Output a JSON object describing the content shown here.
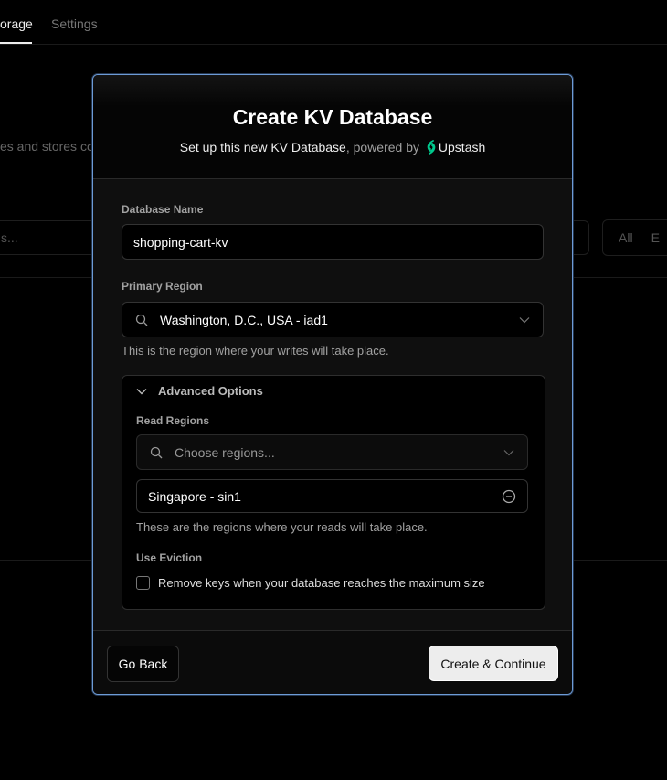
{
  "background": {
    "tabs": [
      {
        "label": "orage",
        "active": true
      },
      {
        "label": "Settings",
        "active": false
      }
    ],
    "description_fragment": "es and stores co",
    "search_fragment": "s...",
    "filters": [
      "All",
      "E"
    ]
  },
  "modal": {
    "title": "Create KV Database",
    "subtitle_main": "Set up this new KV Database",
    "subtitle_powered": ", powered by",
    "provider": "Upstash",
    "provider_color": "#00c98d",
    "database_name": {
      "label": "Database Name",
      "value": "shopping-cart-kv"
    },
    "primary_region": {
      "label": "Primary Region",
      "value": "Washington, D.C., USA - iad1",
      "help": "This is the region where your writes will take place."
    },
    "advanced": {
      "label": "Advanced Options",
      "expanded": true,
      "read_regions": {
        "label": "Read Regions",
        "placeholder": "Choose regions...",
        "selected": [
          "Singapore - sin1"
        ],
        "help": "These are the regions where your reads will take place."
      },
      "eviction": {
        "label": "Use Eviction",
        "checkbox_label": "Remove keys when your database reaches the maximum size",
        "checked": false
      }
    },
    "footer": {
      "back": "Go Back",
      "submit": "Create & Continue"
    }
  },
  "colors": {
    "accent_border": "#6d9bd6"
  }
}
